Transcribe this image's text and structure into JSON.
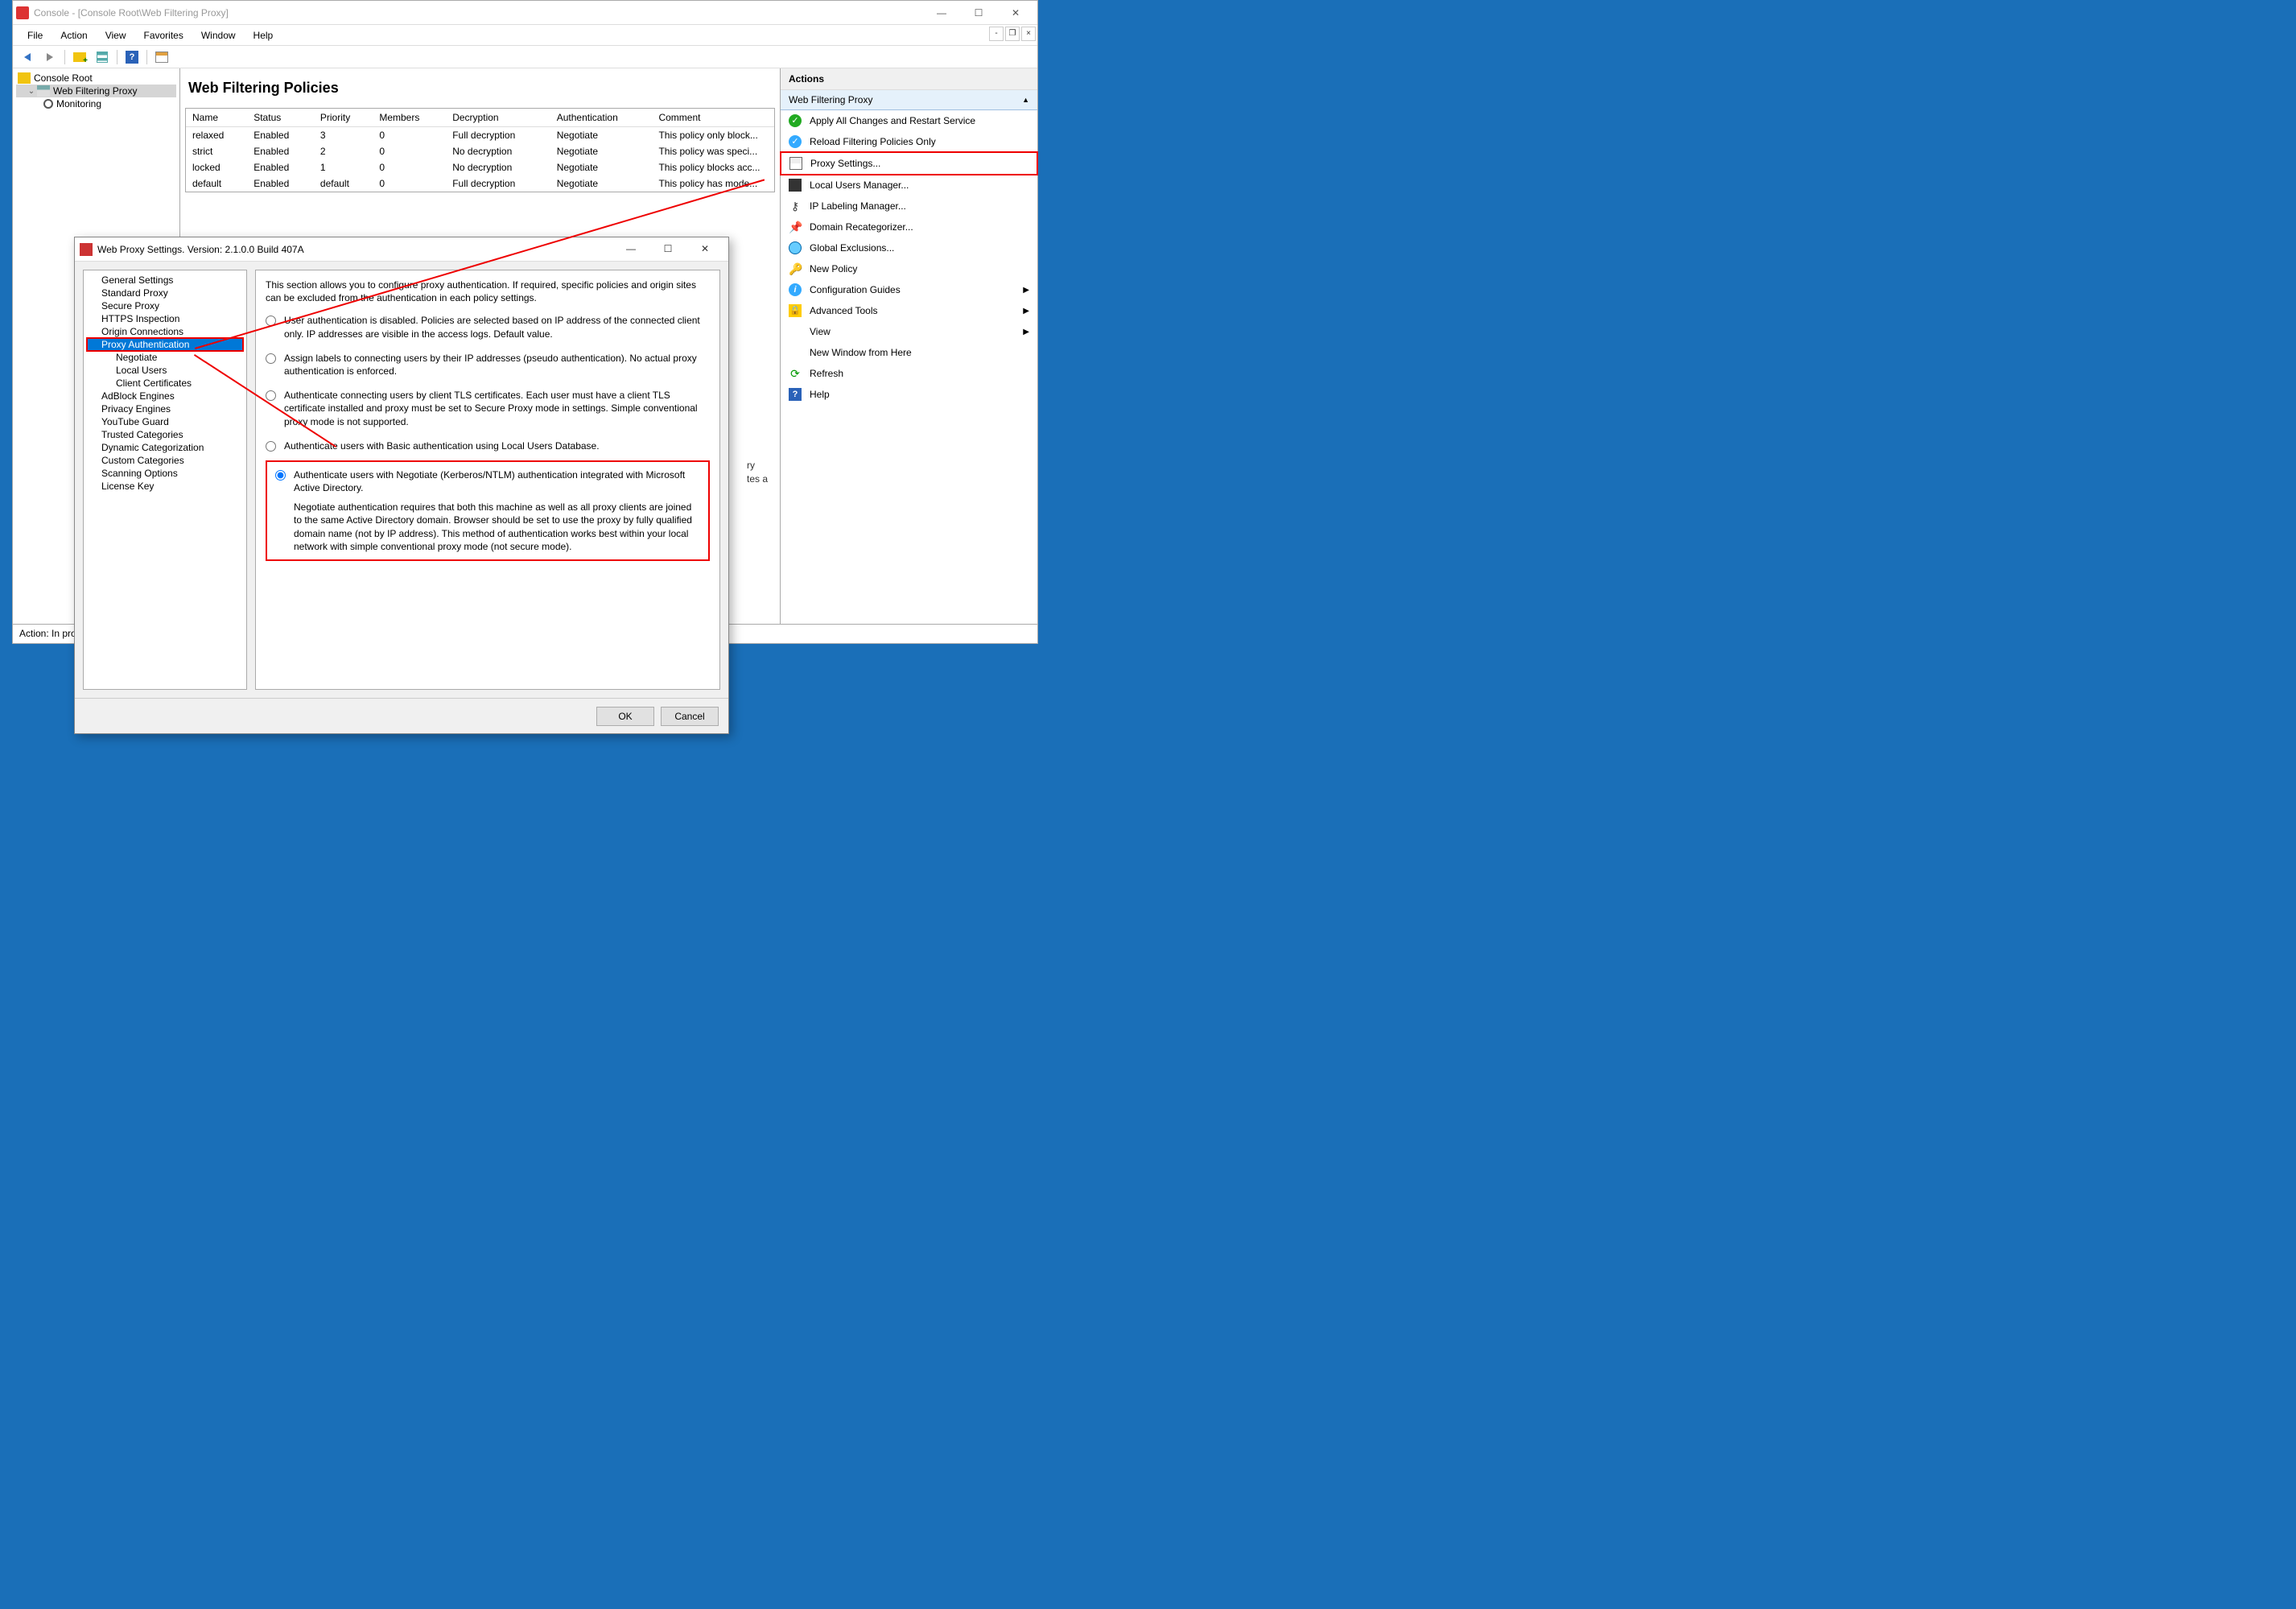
{
  "window": {
    "title": "Console - [Console Root\\Web Filtering Proxy]"
  },
  "menu": {
    "file": "File",
    "action": "Action",
    "view": "View",
    "favorites": "Favorites",
    "window": "Window",
    "help": "Help"
  },
  "tree": {
    "root": "Console Root",
    "proxy": "Web Filtering Proxy",
    "monitoring": "Monitoring"
  },
  "center": {
    "heading": "Web Filtering Policies",
    "cols": {
      "name": "Name",
      "status": "Status",
      "priority": "Priority",
      "members": "Members",
      "decryption": "Decryption",
      "auth": "Authentication",
      "comment": "Comment"
    },
    "rows": [
      {
        "name": "relaxed",
        "status": "Enabled",
        "priority": "3",
        "members": "0",
        "decryption": "Full decryption",
        "auth": "Negotiate",
        "comment": "This policy only block..."
      },
      {
        "name": "strict",
        "status": "Enabled",
        "priority": "2",
        "members": "0",
        "decryption": "No decryption",
        "auth": "Negotiate",
        "comment": "This policy was speci..."
      },
      {
        "name": "locked",
        "status": "Enabled",
        "priority": "1",
        "members": "0",
        "decryption": "No decryption",
        "auth": "Negotiate",
        "comment": "This policy blocks acc..."
      },
      {
        "name": "default",
        "status": "Enabled",
        "priority": "default",
        "members": "0",
        "decryption": "Full decryption",
        "auth": "Negotiate",
        "comment": "This policy has mode..."
      }
    ],
    "note1": "ry",
    "note2": "tes a"
  },
  "actions": {
    "hdr": "Actions",
    "sub": "Web Filtering Proxy",
    "items": {
      "apply": "Apply All Changes and Restart Service",
      "reload": "Reload Filtering Policies Only",
      "proxy_settings": "Proxy Settings...",
      "local_users": "Local Users Manager...",
      "ip_label": "IP Labeling Manager...",
      "recat": "Domain Recategorizer...",
      "excl": "Global Exclusions...",
      "newpol": "New Policy",
      "guides": "Configuration Guides",
      "adv": "Advanced Tools",
      "view": "View",
      "newwin": "New Window from Here",
      "refresh": "Refresh",
      "help": "Help"
    }
  },
  "status": "Action:  In pro",
  "dialog": {
    "title": "Web Proxy Settings. Version: 2.1.0.0 Build 407A",
    "tree": {
      "general": "General Settings",
      "standard": "Standard Proxy",
      "secure": "Secure Proxy",
      "https": "HTTPS Inspection",
      "origin": "Origin Connections",
      "proxyauth": "Proxy Authentication",
      "negotiate": "Negotiate",
      "localusers": "Local Users",
      "clientcert": "Client Certificates",
      "adblock": "AdBlock Engines",
      "privacy": "Privacy Engines",
      "youtube": "YouTube Guard",
      "trusted": "Trusted Categories",
      "dyncat": "Dynamic Categorization",
      "custom": "Custom Categories",
      "scan": "Scanning Options",
      "license": "License Key"
    },
    "desc": "This section allows you to configure proxy authentication.  If required, specific policies and origin sites can be excluded from the authentication in each policy settings.",
    "opt1": "User authentication is disabled. Policies are selected based on IP address of the connected client only. IP addresses are visible in the access logs. Default value.",
    "opt2": "Assign labels to connecting users by their IP addresses (pseudo authentication). No actual proxy authentication is enforced.",
    "opt3": "Authenticate connecting users by client TLS certificates. Each user must have a client TLS certificate installed and proxy must be set to Secure Proxy mode in settings. Simple conventional proxy mode is not supported.",
    "opt4": "Authenticate users with Basic authentication using Local Users Database.",
    "opt5": "Authenticate users with Negotiate (Kerberos/NTLM) authentication integrated with Microsoft Active Directory.",
    "opt5_note": "Negotiate authentication requires that both this machine as well as all proxy clients are joined to the same Active Directory domain. Browser should be set to use the proxy by fully qualified domain name (not by IP address). This method of authentication works best within your local network with simple conventional proxy mode (not secure mode).",
    "ok": "OK",
    "cancel": "Cancel"
  }
}
